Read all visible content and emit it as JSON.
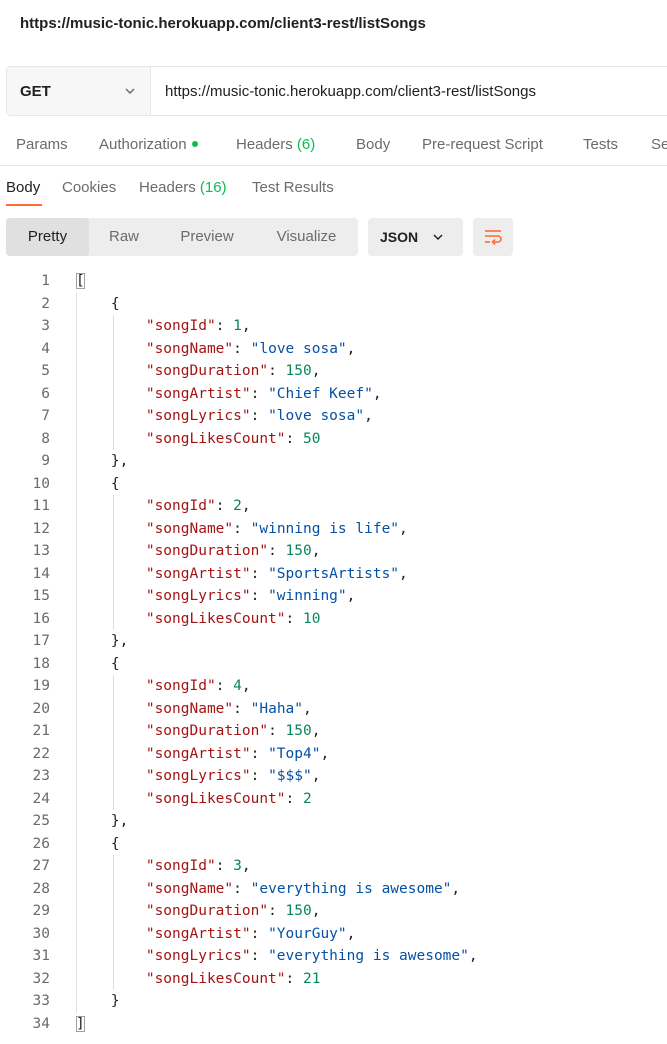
{
  "window": {
    "title": "https://music-tonic.herokuapp.com/client3-rest/listSongs"
  },
  "request": {
    "method": "GET",
    "url": "https://music-tonic.herokuapp.com/client3-rest/listSongs",
    "tabs": [
      {
        "label": "Params"
      },
      {
        "label": "Authorization",
        "indicator": "green-dot"
      },
      {
        "label": "Headers",
        "count": "(6)"
      },
      {
        "label": "Body"
      },
      {
        "label": "Pre-request Script"
      },
      {
        "label": "Tests"
      },
      {
        "label": "Se"
      }
    ]
  },
  "response": {
    "tabs": [
      {
        "label": "Body"
      },
      {
        "label": "Cookies"
      },
      {
        "label": "Headers",
        "count": "(16)"
      },
      {
        "label": "Test Results"
      }
    ],
    "view_modes": [
      "Pretty",
      "Raw",
      "Preview",
      "Visualize"
    ],
    "active_view": "Pretty",
    "format": "JSON",
    "wrap_icon": "wrap-lines-icon",
    "songs": [
      {
        "songId": 1,
        "songName": "love sosa",
        "songDuration": 150,
        "songArtist": "Chief Keef",
        "songLyrics": "love sosa",
        "songLikesCount": 50
      },
      {
        "songId": 2,
        "songName": "winning is life",
        "songDuration": 150,
        "songArtist": "SportsArtists",
        "songLyrics": "winning",
        "songLikesCount": 10
      },
      {
        "songId": 4,
        "songName": "Haha",
        "songDuration": 150,
        "songArtist": "Top4",
        "songLyrics": "$$$",
        "songLikesCount": 2
      },
      {
        "songId": 3,
        "songName": "everything is awesome",
        "songDuration": 150,
        "songArtist": "YourGuy",
        "songLyrics": "everything is awesome",
        "songLikesCount": 21
      }
    ]
  },
  "colors": {
    "accent": "#ff6c37",
    "status_green": "#0cbb52",
    "json_key": "#a31515",
    "json_string": "#0451a5",
    "json_number": "#098658"
  }
}
